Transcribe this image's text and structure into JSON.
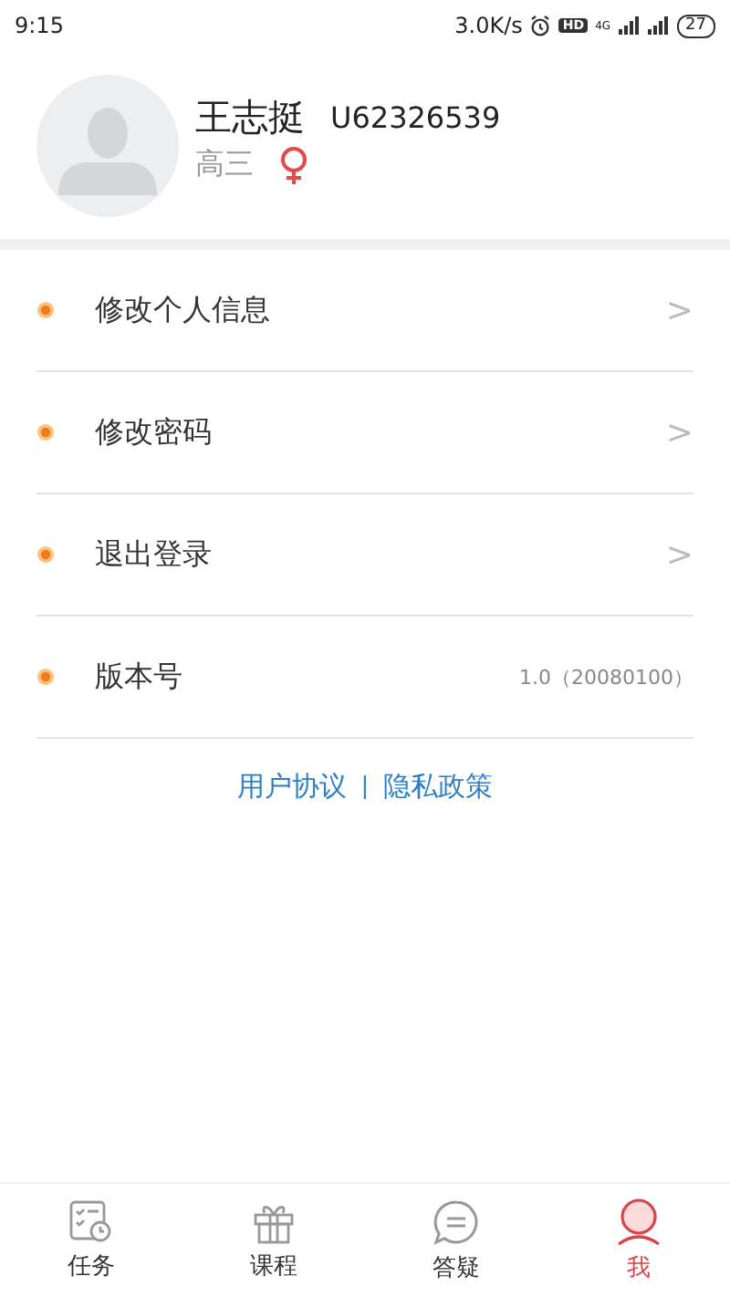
{
  "status_bar": {
    "time": "9:15",
    "speed": "3.0K/s",
    "hd": "HD",
    "network": "4G",
    "battery": "27"
  },
  "profile": {
    "name": "王志挺",
    "user_id": "U62326539",
    "grade": "高三",
    "female": true
  },
  "menu": [
    {
      "kind": "link",
      "label": "修改个人信息",
      "arrow": ">"
    },
    {
      "kind": "link",
      "label": "修改密码",
      "arrow": ">"
    },
    {
      "kind": "link",
      "label": "退出登录",
      "arrow": ">"
    },
    {
      "kind": "info",
      "label": "版本号",
      "value": "1.0（20080100）"
    }
  ],
  "footer_links": [
    {
      "label": "用户协议"
    },
    {
      "label": "隐私政策"
    }
  ],
  "footer_separator": "|",
  "tabs": [
    {
      "kind": "tasks",
      "label": "任务",
      "selected": false
    },
    {
      "kind": "courses",
      "label": "课程",
      "selected": false
    },
    {
      "kind": "qa",
      "label": "答疑",
      "selected": false
    },
    {
      "kind": "me",
      "label": "我",
      "selected": true
    }
  ]
}
